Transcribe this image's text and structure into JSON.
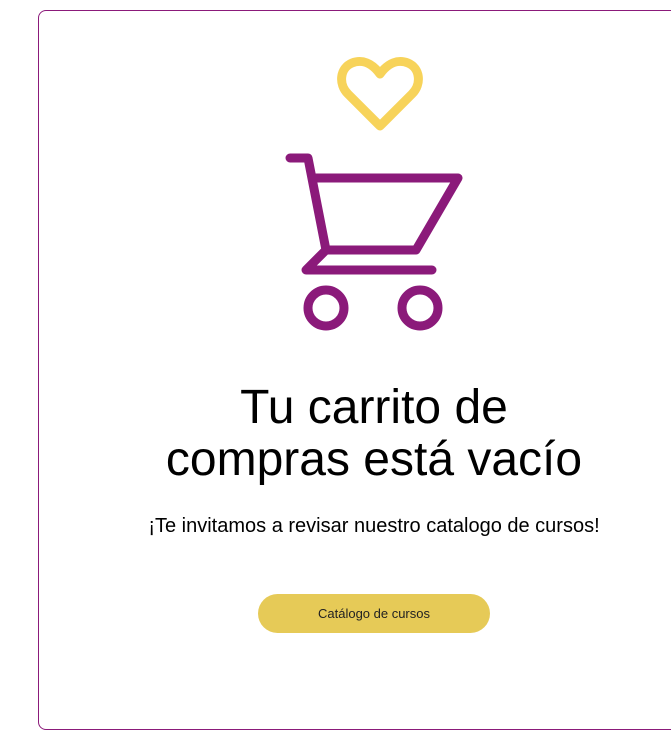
{
  "colors": {
    "accent_purple": "#8b1a7a",
    "accent_yellow": "#f7d35a",
    "button_bg": "#e6ca57"
  },
  "icons": {
    "heart": "heart-icon",
    "cart": "shopping-cart-icon"
  },
  "empty_cart": {
    "title_line1": "Tu carrito de",
    "title_line2": "compras está vacío",
    "subtitle": "¡Te invitamos a revisar nuestro catalogo de cursos!",
    "button_label": "Catálogo de cursos"
  }
}
